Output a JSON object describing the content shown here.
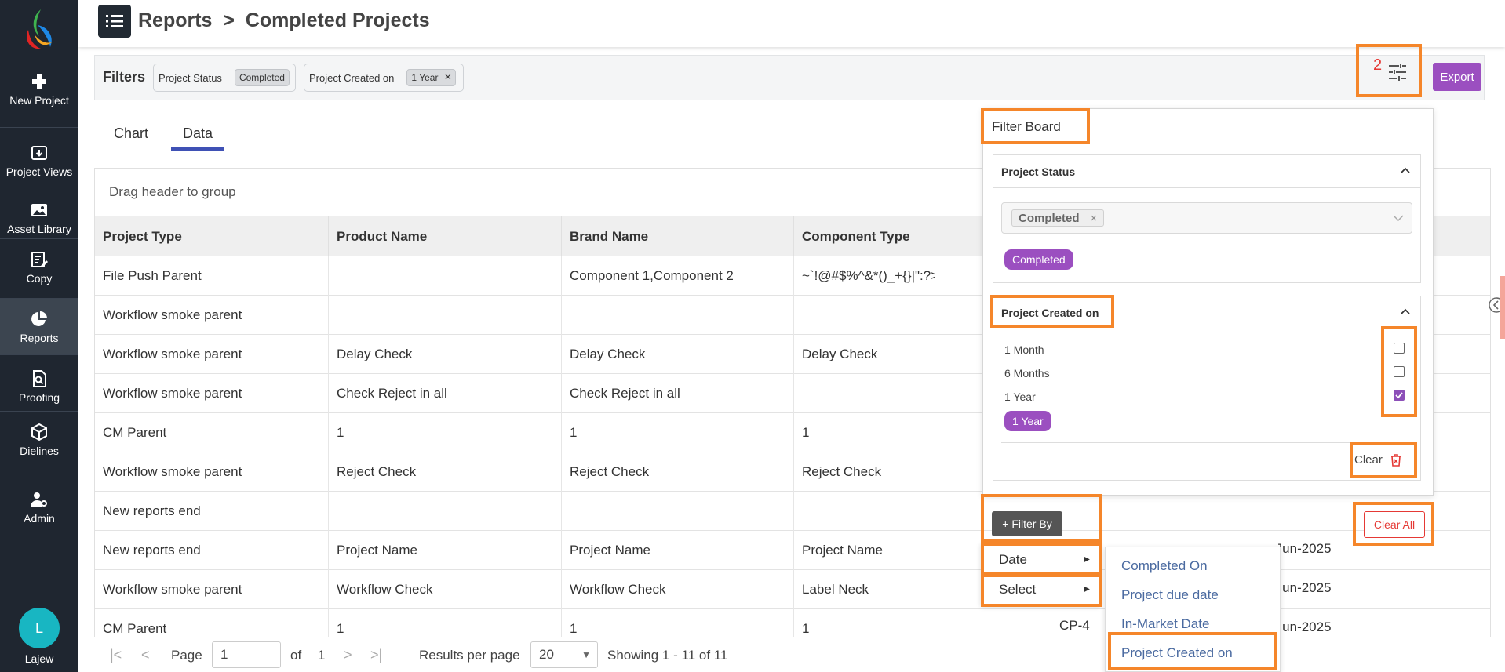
{
  "sidebar": {
    "items": [
      {
        "label": "New Project",
        "icon": "plus-icon"
      },
      {
        "label": "Project Views",
        "icon": "download-box-icon"
      },
      {
        "label": "Asset Library",
        "icon": "image-icon"
      },
      {
        "label": "Copy",
        "icon": "edit-doc-icon"
      },
      {
        "label": "Reports",
        "icon": "pie-chart-icon"
      },
      {
        "label": "Proofing",
        "icon": "search-doc-icon"
      },
      {
        "label": "Dielines",
        "icon": "box-icon"
      },
      {
        "label": "Admin",
        "icon": "user-gear-icon"
      }
    ],
    "user_initial": "L",
    "user_name": "Lajew"
  },
  "header": {
    "title": "Reports  >  Completed Projects"
  },
  "filters": {
    "label": "Filters",
    "chips": [
      {
        "name": "Project Status",
        "value": "Completed"
      },
      {
        "name": "Project Created on",
        "value": "1 Year"
      }
    ],
    "count": "2",
    "export_label": "Export"
  },
  "tabs": [
    {
      "label": "Chart"
    },
    {
      "label": "Data"
    }
  ],
  "grid": {
    "drag_label": "Drag header to group",
    "columns": [
      "Project Type",
      "Product Name",
      "Brand Name",
      "Component Type"
    ],
    "rows": [
      [
        "File Push Parent",
        "",
        "Component 1,Component 2",
        "~`!@#$%^&*()_+{}|\":?><,./;'[]\\="
      ],
      [
        "Workflow smoke parent",
        "",
        "",
        ""
      ],
      [
        "Workflow smoke parent",
        "Delay Check",
        "Delay Check",
        "Delay Check"
      ],
      [
        "Workflow smoke parent",
        "Check Reject in all",
        "Check Reject in all",
        ""
      ],
      [
        "CM Parent",
        "1",
        "1",
        "1"
      ],
      [
        "Workflow smoke parent",
        "Reject Check",
        "Reject Check",
        "Reject Check"
      ],
      [
        "New reports end",
        "",
        "",
        ""
      ],
      [
        "New reports end",
        "Project Name",
        "Project Name",
        "Project Name"
      ],
      [
        "Workflow smoke parent",
        "Workflow Check",
        "Workflow Check",
        "Label Neck"
      ],
      [
        "CM Parent",
        "1",
        "1",
        "1"
      ]
    ],
    "extra_cells": {
      "date_1": "-Jun-2025",
      "date_2": "-Jun-2025",
      "date_3": "-Jun-2025",
      "code_1": "CP-4"
    }
  },
  "pager": {
    "page_label": "Page",
    "page_value": "1",
    "of_label": "of",
    "total_pages": "1",
    "results_label": "Results per page",
    "results_value": "20",
    "showing": "Showing 1 - 11 of 11"
  },
  "board": {
    "title": "Filter Board",
    "status_section": {
      "title": "Project Status",
      "selected_chip": "Completed",
      "applied": "Completed"
    },
    "created_section": {
      "title": "Project Created on",
      "options": [
        {
          "label": "1 Month",
          "checked": false
        },
        {
          "label": "6 Months",
          "checked": false
        },
        {
          "label": "1 Year",
          "checked": true
        }
      ],
      "applied": "1 Year",
      "clear_label": "Clear"
    },
    "filter_by_label": "+ Filter By",
    "clear_all_label": "Clear All",
    "menu": [
      {
        "label": "Date"
      },
      {
        "label": "Select"
      }
    ],
    "submenu": [
      {
        "label": "Completed On"
      },
      {
        "label": "Project due date"
      },
      {
        "label": "In-Market Date"
      },
      {
        "label": "Project Created on"
      }
    ]
  },
  "colors": {
    "sidebar": "#1f2630",
    "accent_purple": "#9b4fc0",
    "highlight_orange": "#f5862a",
    "tab_blue": "#3f51b5",
    "danger": "#e53935"
  }
}
